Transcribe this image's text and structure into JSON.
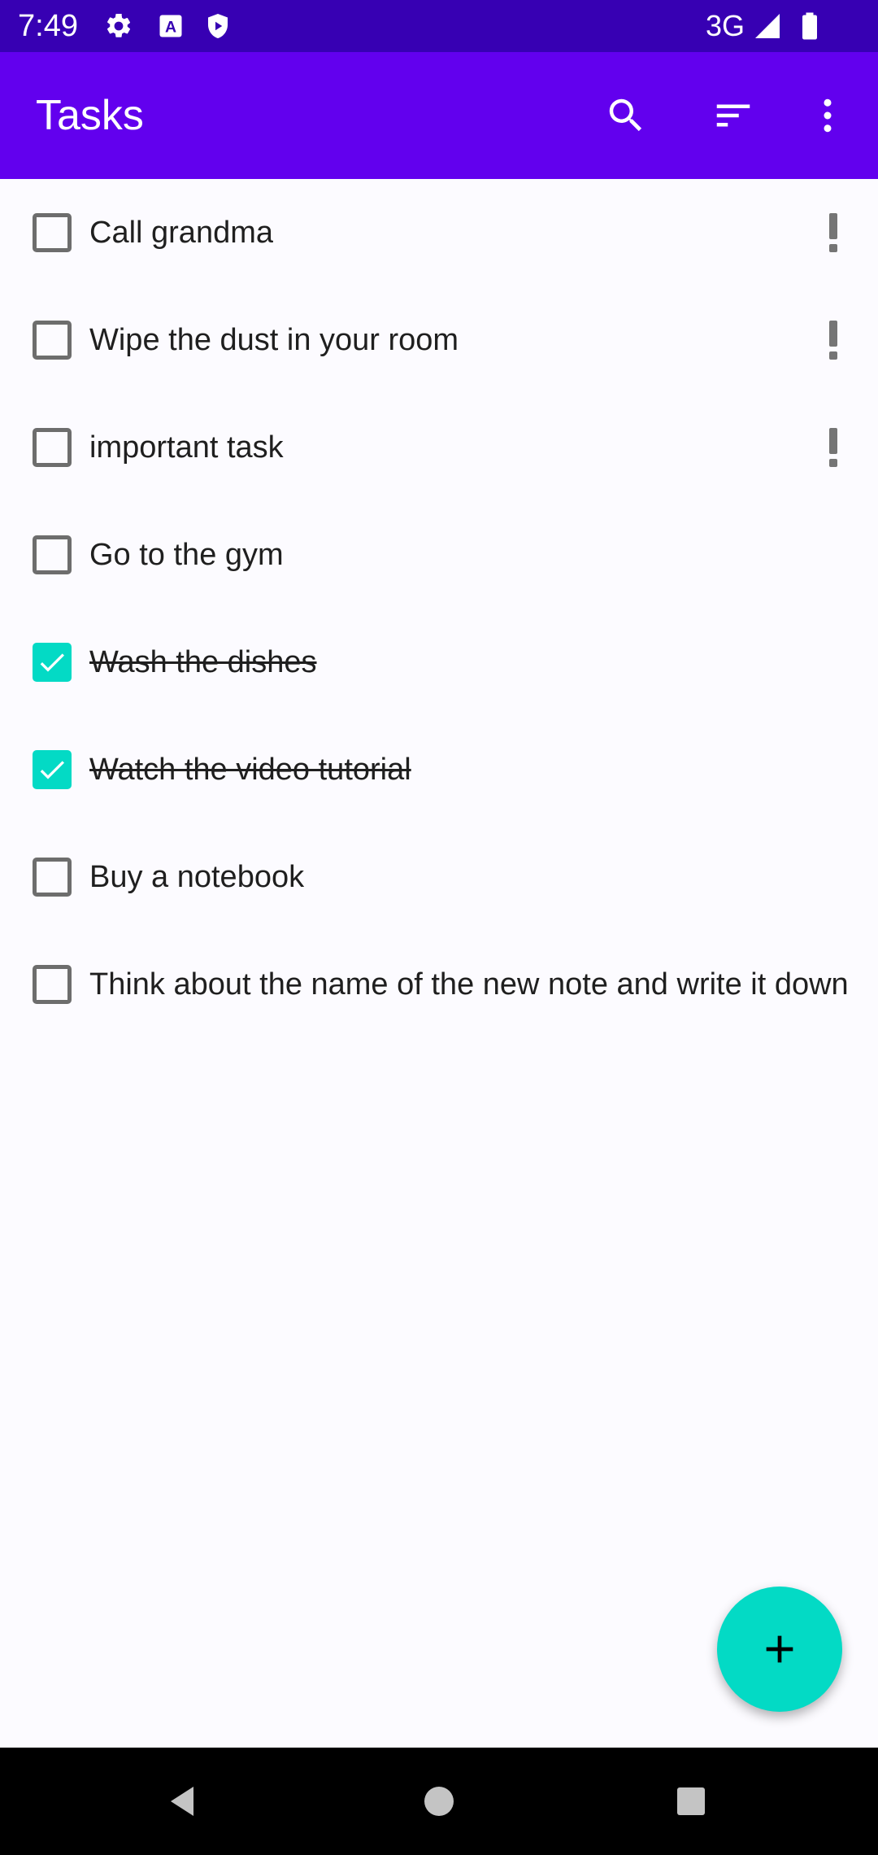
{
  "status_bar": {
    "time": "7:49",
    "network": "3G",
    "icons": [
      "settings-icon",
      "a-box-icon",
      "shield-play-icon",
      "signal-icon",
      "battery-icon"
    ]
  },
  "app_bar": {
    "title": "Tasks",
    "actions": [
      "search-icon",
      "sort-icon",
      "more-vert-icon"
    ]
  },
  "tasks": [
    {
      "label": "Call grandma",
      "completed": false,
      "important": true
    },
    {
      "label": "Wipe the dust in your room",
      "completed": false,
      "important": true
    },
    {
      "label": "important task",
      "completed": false,
      "important": true
    },
    {
      "label": "Go to the gym",
      "completed": false,
      "important": false
    },
    {
      "label": "Wash the dishes",
      "completed": true,
      "important": false
    },
    {
      "label": "Watch the video tutorial",
      "completed": true,
      "important": false
    },
    {
      "label": "Buy a notebook",
      "completed": false,
      "important": false
    },
    {
      "label": "Think about the name of the new note and write it down",
      "completed": false,
      "important": false
    }
  ],
  "fab": {
    "icon": "add-icon"
  },
  "nav_bar": {
    "buttons": [
      "back-icon",
      "home-icon",
      "recents-icon"
    ]
  },
  "colors": {
    "status_bar": "#3700b3",
    "app_bar": "#6200ee",
    "accent": "#03dac5",
    "checkbox_border": "#6d6d6d",
    "priority_icon": "#757575"
  }
}
